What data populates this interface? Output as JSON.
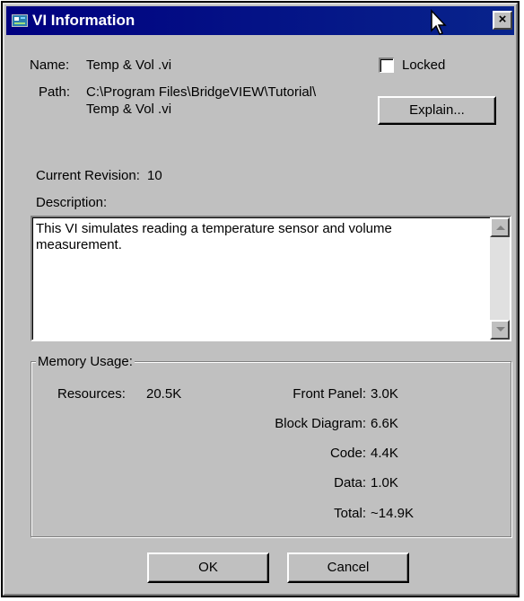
{
  "window": {
    "title": "VI Information"
  },
  "titlebar": {
    "close_label": "×"
  },
  "info": {
    "name_label": "Name:",
    "name_value": "Temp & Vol .vi",
    "path_label": "Path:",
    "path_line1": "C:\\Program Files\\BridgeVIEW\\Tutorial\\",
    "path_line2": "Temp & Vol .vi",
    "locked_label": "Locked",
    "locked_checked": false,
    "explain_button": "Explain...",
    "revision_label": "Current Revision:",
    "revision_value": "10",
    "description_label": "Description:",
    "description_text": "This VI simulates reading a temperature sensor and volume measurement."
  },
  "memory": {
    "group_title": "Memory Usage:",
    "resources_label": "Resources:",
    "resources_value": "20.5K",
    "front_panel_label": "Front Panel:",
    "front_panel_value": "3.0K",
    "block_diagram_label": "Block Diagram:",
    "block_diagram_value": "6.6K",
    "code_label": "Code:",
    "code_value": "4.4K",
    "data_label": "Data:",
    "data_value": "1.0K",
    "total_label": "Total:",
    "total_value": "~14.9K"
  },
  "buttons": {
    "ok": "OK",
    "cancel": "Cancel"
  },
  "icons": {
    "title": "window-app-icon",
    "cursor": "mouse-pointer-icon",
    "close": "close-icon",
    "scroll_up": "arrow-up-icon",
    "scroll_down": "arrow-down-icon"
  }
}
